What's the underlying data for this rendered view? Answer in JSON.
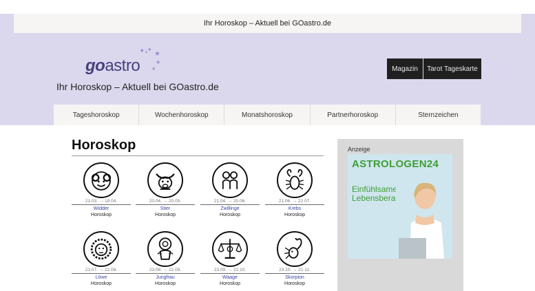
{
  "header": {
    "page_title": "Ihr Horoskop – Aktuell bei GOastro.de",
    "logo_prefix": "go",
    "logo_suffix": "astro",
    "tagline": "Ihr Horoskop – Aktuell bei GOastro.de",
    "buttons": [
      "Magazin",
      "Tarot Tageskarte"
    ]
  },
  "nav": {
    "items": [
      "Tageshoroskop",
      "Wochenhoroskop",
      "Monatshoroskop",
      "Partnerhoroskop",
      "Sternzeichen"
    ]
  },
  "main": {
    "title": "Horoskop",
    "signs": [
      {
        "dates": "21.03. → 19.04.",
        "name": "Widder",
        "suffix": "Horoskop"
      },
      {
        "dates": "20.04. → 20.05.",
        "name": "Stier",
        "suffix": "Horoskop"
      },
      {
        "dates": "21.04. → 20.06.",
        "name": "Zwillinge",
        "suffix": "Horoskop"
      },
      {
        "dates": "21.06. → 22.07.",
        "name": "Krebs",
        "suffix": "Horoskop"
      },
      {
        "dates": "23.07. → 22.08.",
        "name": "Löwe",
        "suffix": "Horoskop"
      },
      {
        "dates": "23.08. → 22.09.",
        "name": "Jungfrau",
        "suffix": "Horoskop"
      },
      {
        "dates": "23.09. → 22.10.",
        "name": "Waage",
        "suffix": "Horoskop"
      },
      {
        "dates": "23.10. → 21.11.",
        "name": "Skorpion",
        "suffix": "Horoskop"
      }
    ]
  },
  "ad": {
    "label": "Anzeige",
    "brand": "ASTROLOGEN",
    "brand_num": "24",
    "text": "Einfühlsame Lebensberatung"
  },
  "colors": {
    "band": "#dbd8ee",
    "logo": "#46407e",
    "link": "#3a44a0",
    "ad_green": "#3f9d35"
  }
}
